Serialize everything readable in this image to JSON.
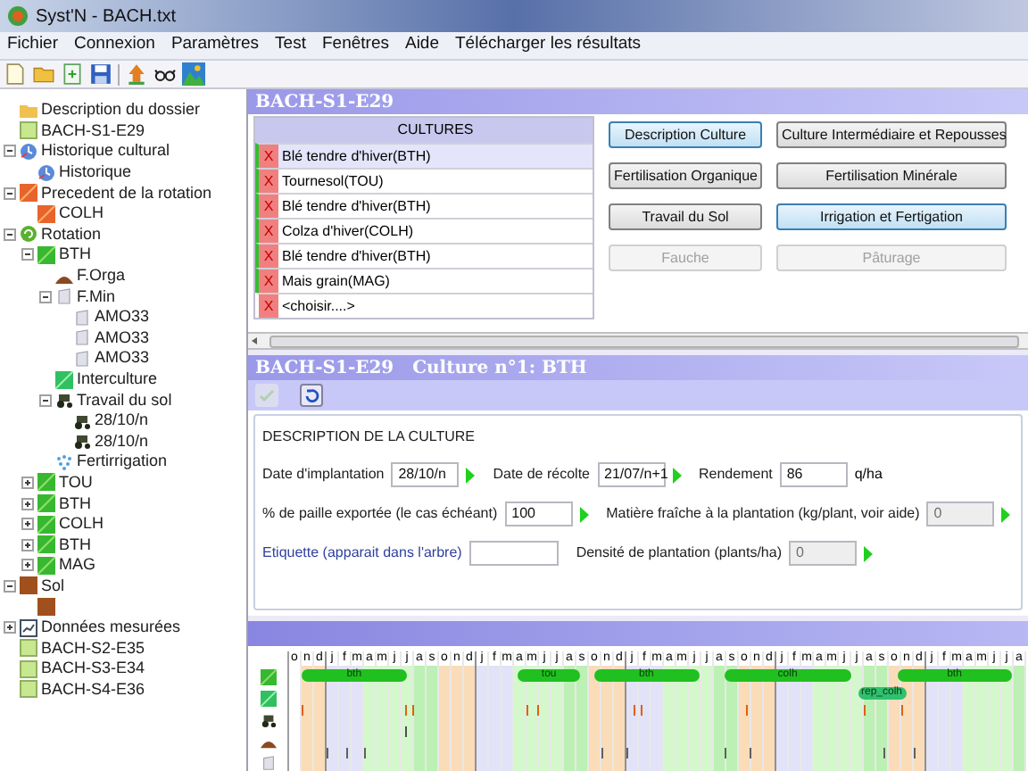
{
  "window": {
    "title": "Syst'N - BACH.txt"
  },
  "menu": [
    "Fichier",
    "Connexion",
    "Paramètres",
    "Test",
    "Fenêtres",
    "Aide",
    "Télécharger les résultats"
  ],
  "toolbar": [
    {
      "kind": "new"
    },
    {
      "kind": "open"
    },
    {
      "kind": "import"
    },
    {
      "kind": "save"
    },
    {
      "kind": "upload"
    },
    {
      "kind": "glasses"
    },
    {
      "kind": "map"
    }
  ],
  "tree": [
    {
      "label": "Description du dossier",
      "kind": "folder"
    },
    {
      "label": "BACH-S1-E29",
      "kind": "site"
    },
    {
      "label": "Historique cultural",
      "kind": "history",
      "expanded": true,
      "children": [
        {
          "label": "Historique",
          "kind": "history"
        }
      ]
    },
    {
      "label": "Precedent de la rotation",
      "kind": "previous",
      "expanded": true,
      "children": [
        {
          "label": "COLH",
          "kind": "previous"
        }
      ]
    },
    {
      "label": "Rotation",
      "kind": "rotation",
      "expanded": true,
      "children": [
        {
          "label": "BTH",
          "kind": "crop",
          "expanded": true,
          "children": [
            {
              "label": "F.Orga",
              "kind": "orga"
            },
            {
              "label": "F.Min",
              "kind": "min",
              "expanded": true,
              "children": [
                {
                  "label": "AMO33",
                  "kind": "min"
                },
                {
                  "label": "AMO33",
                  "kind": "min"
                },
                {
                  "label": "AMO33",
                  "kind": "min"
                }
              ]
            },
            {
              "label": "Interculture",
              "kind": "interculture"
            },
            {
              "label": "Travail du sol",
              "kind": "tillage",
              "expanded": true,
              "children": [
                {
                  "label": "28/10/n",
                  "kind": "tillage"
                },
                {
                  "label": "28/10/n",
                  "kind": "tillage"
                }
              ]
            },
            {
              "label": "Fertirrigation",
              "kind": "fertirrigation"
            }
          ]
        },
        {
          "label": "TOU",
          "kind": "crop",
          "expanded": false
        },
        {
          "label": "BTH",
          "kind": "crop",
          "expanded": false
        },
        {
          "label": "COLH",
          "kind": "crop",
          "expanded": false
        },
        {
          "label": "BTH",
          "kind": "crop",
          "expanded": false
        },
        {
          "label": "MAG",
          "kind": "crop",
          "expanded": false
        }
      ]
    },
    {
      "label": "Sol",
      "kind": "soil",
      "expanded": true,
      "children": [
        {
          "kind": "soil"
        }
      ]
    },
    {
      "label": "Données mesurées",
      "kind": "measured",
      "expanded": false
    },
    {
      "label": "BACH-S2-E35",
      "kind": "site"
    },
    {
      "label": "BACH-S3-E34",
      "kind": "site"
    },
    {
      "label": "BACH-S4-E36",
      "kind": "site"
    }
  ],
  "top_panel": {
    "title": "BACH-S1-E29",
    "table": {
      "column": "CULTURES",
      "rows": [
        {
          "delete": "X",
          "name": "Blé tendre d'hiver(BTH)",
          "selected": true,
          "filled": true
        },
        {
          "delete": "X",
          "name": "Tournesol(TOU)",
          "selected": false,
          "filled": true
        },
        {
          "delete": "X",
          "name": "Blé tendre d'hiver(BTH)",
          "selected": false,
          "filled": true
        },
        {
          "delete": "X",
          "name": "Colza d'hiver(COLH)",
          "selected": false,
          "filled": true
        },
        {
          "delete": "X",
          "name": "Blé tendre d'hiver(BTH)",
          "selected": false,
          "filled": true
        },
        {
          "delete": "X",
          "name": "Mais grain(MAG)",
          "selected": false,
          "filled": true
        },
        {
          "delete": "X",
          "name": "<choisir....>",
          "selected": false,
          "filled": false
        }
      ]
    },
    "buttons": [
      {
        "label": "Description Culture",
        "selected": true,
        "disabled": false
      },
      {
        "label": "Culture Intermédiaire et Repousses",
        "selected": false,
        "disabled": false
      },
      {
        "label": "Fertilisation Organique",
        "selected": false,
        "disabled": false
      },
      {
        "label": "Fertilisation Minérale",
        "selected": false,
        "disabled": false
      },
      {
        "label": "Travail du Sol",
        "selected": false,
        "disabled": false
      },
      {
        "label": "Irrigation et Fertigation",
        "selected": true,
        "disabled": false
      },
      {
        "label": "Fauche",
        "selected": false,
        "disabled": true
      },
      {
        "label": "Pâturage",
        "selected": false,
        "disabled": true
      }
    ]
  },
  "detail_panel": {
    "title": "BACH-S1-E29   Culture n°1: BTH",
    "toolbar": [
      {
        "kind": "check",
        "disabled": true
      },
      {
        "kind": "undo",
        "disabled": false
      }
    ],
    "group": "DESCRIPTION DE LA CULTURE",
    "rows": [
      [
        {
          "kind": "picker",
          "label": "Date d'implantation",
          "value": "28/10/n",
          "disabled": false,
          "link": false
        },
        {
          "kind": "picker",
          "label": "Date de récolte",
          "value": "21/07/n+1",
          "disabled": false,
          "link": false
        },
        {
          "kind": "plain",
          "label": "Rendement",
          "value": "86",
          "unit": "q/ha",
          "disabled": false,
          "link": false
        }
      ],
      [
        {
          "kind": "picker",
          "label": "% de paille exportée (le cas échéant)",
          "value": "100",
          "disabled": false,
          "link": false
        },
        {
          "kind": "picker",
          "label": "Matière fraîche à la plantation (kg/plant, voir aide)",
          "value": "0",
          "disabled": true,
          "link": false
        }
      ],
      [
        {
          "kind": "plain",
          "label": "Etiquette (apparait dans l'arbre)",
          "link": true,
          "disabled": false
        },
        {
          "kind": "picker",
          "label": "Densité de plantation (plants/ha)",
          "value": "0",
          "disabled": true,
          "link": false
        }
      ]
    ]
  },
  "timeline": {
    "months": [
      "o",
      "n",
      "d",
      "j",
      "f",
      "m",
      "a",
      "m",
      "j",
      "j",
      "a",
      "s",
      "o",
      "n",
      "d",
      "j",
      "f",
      "m",
      "a",
      "m",
      "j",
      "j",
      "a",
      "s",
      "o",
      "n",
      "d",
      "j",
      "f",
      "m",
      "a",
      "m",
      "j",
      "j",
      "a",
      "s",
      "o",
      "n",
      "d",
      "j",
      "f",
      "m",
      "a",
      "m",
      "j",
      "j",
      "a",
      "s",
      "o",
      "n",
      "d",
      "j",
      "f",
      "m",
      "a",
      "m",
      "j",
      "j",
      "a"
    ],
    "crops": [
      "bth",
      "tou",
      "bth",
      "colh",
      "bth"
    ],
    "regrowth": "rep_colh",
    "rows": [
      {
        "kind": "crop"
      },
      {
        "kind": "interculture"
      },
      {
        "kind": "tillage"
      },
      {
        "kind": "orga"
      },
      {
        "kind": "min"
      }
    ]
  }
}
